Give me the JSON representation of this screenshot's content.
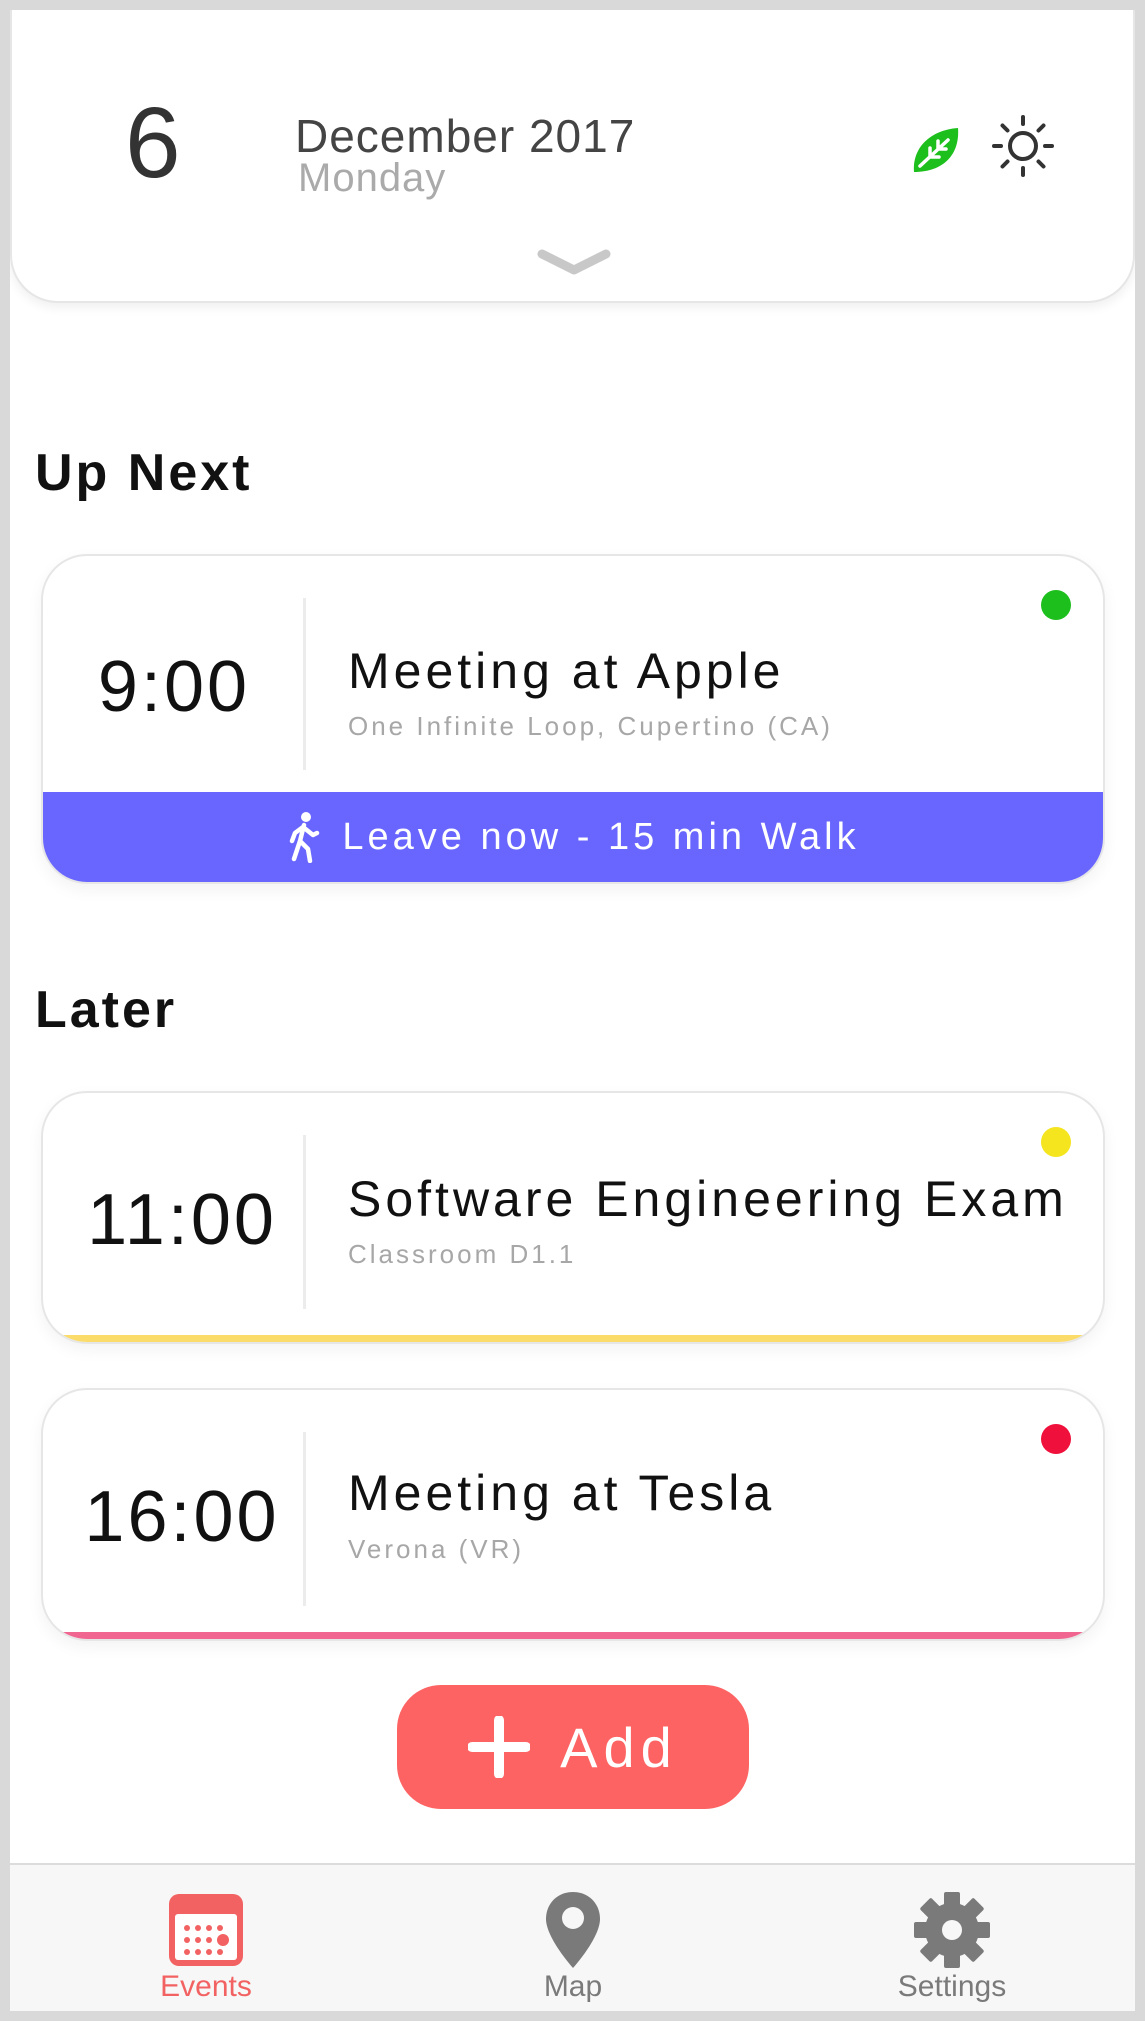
{
  "header": {
    "day": "6",
    "month_year": "December 2017",
    "weekday": "Monday"
  },
  "sections": {
    "up_next": "Up Next",
    "later": "Later"
  },
  "up_next_event": {
    "time": "9:00",
    "title": "Meeting at Apple",
    "location": "One Infinite Loop, Cupertino (CA)",
    "status_color": "#1dbf1d",
    "leave_text": "Leave now - 15 min Walk",
    "leave_color": "#6966ff"
  },
  "later_events": [
    {
      "time": "11:00",
      "title": "Software Engineering Exam",
      "location": "Classroom D1.1",
      "status_color": "#f5e51e",
      "bar_color": "#fbdc6a"
    },
    {
      "time": "16:00",
      "title": "Meeting at Tesla",
      "location": "Verona (VR)",
      "status_color": "#f0103c",
      "bar_color": "#f06690"
    }
  ],
  "add_button": {
    "label": "Add",
    "color": "#fe6363"
  },
  "tabbar": {
    "tabs": [
      {
        "label": "Events",
        "icon": "calendar-icon",
        "active": true
      },
      {
        "label": "Map",
        "icon": "map-pin-icon",
        "active": false
      },
      {
        "label": "Settings",
        "icon": "gear-icon",
        "active": false
      }
    ],
    "active_color": "#f26262",
    "inactive_color": "#7a7a7a"
  },
  "colors": {
    "leaf": "#1dbf1d"
  }
}
